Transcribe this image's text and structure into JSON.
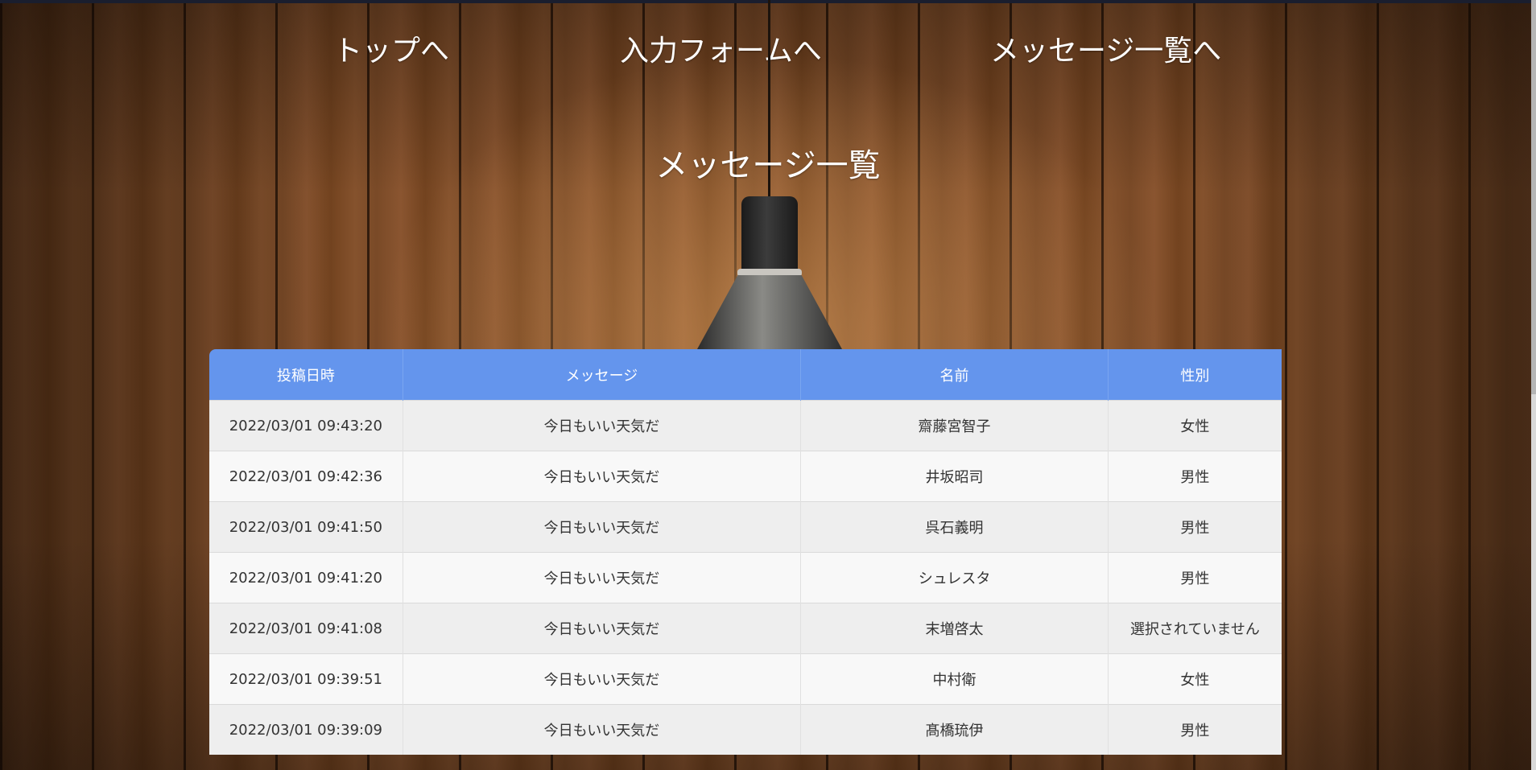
{
  "nav": {
    "top": "トップへ",
    "form": "入力フォームへ",
    "list": "メッセージ一覧へ"
  },
  "page_title": "メッセージ一覧",
  "table": {
    "headers": [
      "投稿日時",
      "メッセージ",
      "名前",
      "性別"
    ],
    "rows": [
      {
        "date": "2022/03/01 09:43:20",
        "message": "今日もいい天気だ",
        "name": "齋藤宮智子",
        "sex": "女性"
      },
      {
        "date": "2022/03/01 09:42:36",
        "message": "今日もいい天気だ",
        "name": "井坂昭司",
        "sex": "男性"
      },
      {
        "date": "2022/03/01 09:41:50",
        "message": "今日もいい天気だ",
        "name": "呉石義明",
        "sex": "男性"
      },
      {
        "date": "2022/03/01 09:41:20",
        "message": "今日もいい天気だ",
        "name": "シュレスタ",
        "sex": "男性"
      },
      {
        "date": "2022/03/01 09:41:08",
        "message": "今日もいい天気だ",
        "name": "末増啓太",
        "sex": "選択されていません"
      },
      {
        "date": "2022/03/01 09:39:51",
        "message": "今日もいい天気だ",
        "name": "中村衛",
        "sex": "女性"
      },
      {
        "date": "2022/03/01 09:39:09",
        "message": "今日もいい天気だ",
        "name": "髙橋琉伊",
        "sex": "男性"
      }
    ]
  },
  "colors": {
    "header_bg": "#6495ed",
    "row_odd": "#eeeeee",
    "row_even": "#f8f8f8",
    "nav_text": "#ffffff"
  }
}
